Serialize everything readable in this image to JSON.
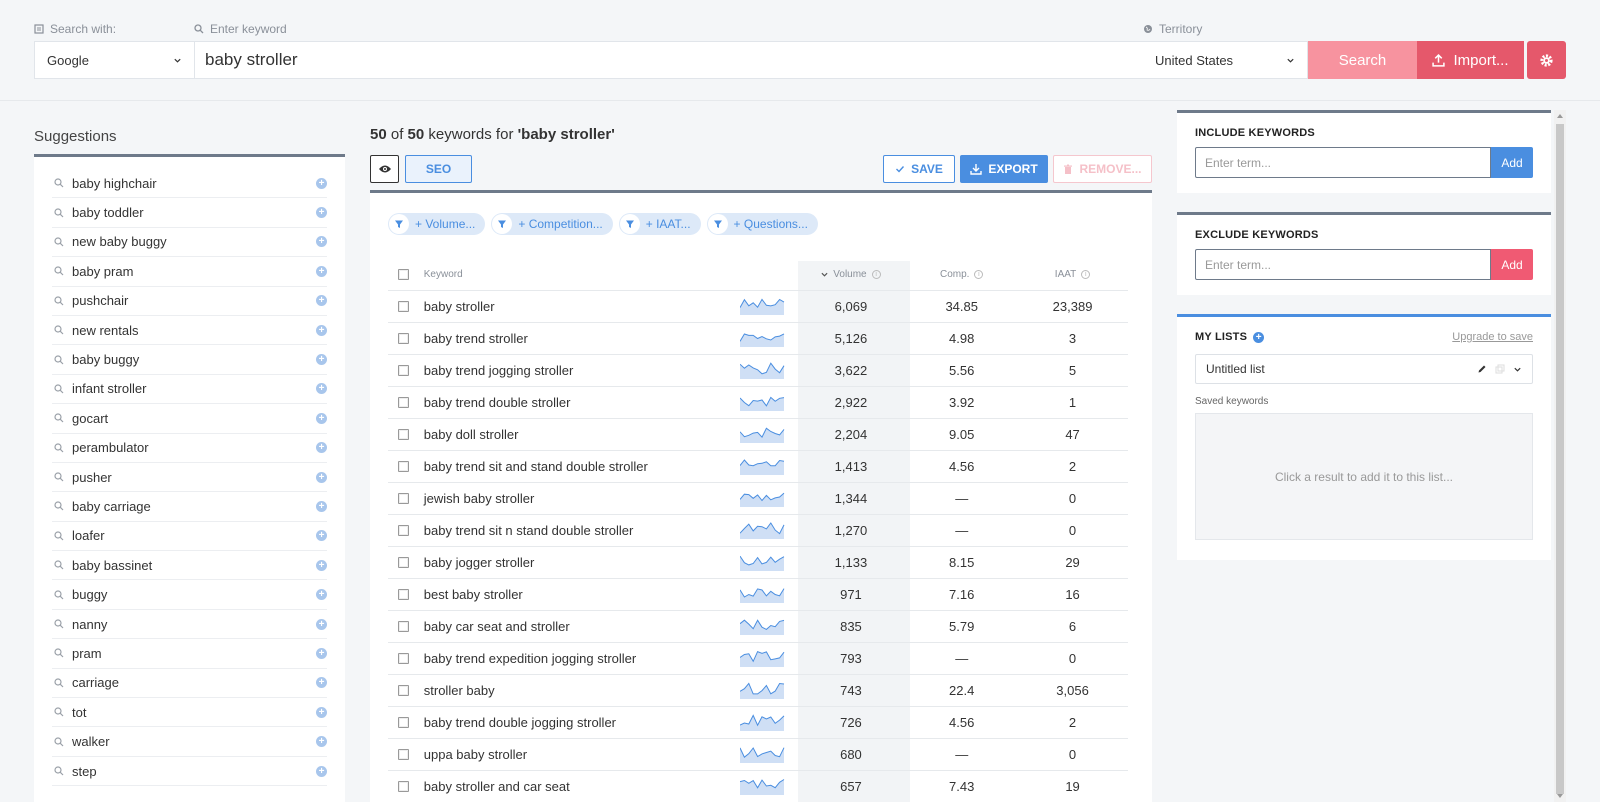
{
  "search": {
    "search_with_label": "Search with:",
    "keyword_label": "Enter keyword",
    "territory_label": "Territory",
    "engine": "Google",
    "keyword_value": "baby stroller",
    "territory": "United States",
    "search_button": "Search",
    "import_button": "Import..."
  },
  "suggestions": {
    "title": "Suggestions",
    "items": [
      "baby highchair",
      "baby toddler",
      "new baby buggy",
      "baby pram",
      "pushchair",
      "new rentals",
      "baby buggy",
      "infant stroller",
      "gocart",
      "perambulator",
      "pusher",
      "baby carriage",
      "loafer",
      "baby bassinet",
      "buggy",
      "nanny",
      "pram",
      "carriage",
      "tot",
      "walker",
      "step"
    ]
  },
  "results": {
    "count_shown": "50",
    "of_text": "of",
    "count_total": "50",
    "keywords_for": "keywords for",
    "query": "'baby stroller'",
    "seo_button": "SEO",
    "save_button": "SAVE",
    "export_button": "EXPORT",
    "remove_button": "REMOVE...",
    "filters": [
      "+ Volume...",
      "+ Competition...",
      "+ IAAT...",
      "+ Questions..."
    ],
    "columns": {
      "keyword": "Keyword",
      "volume": "Volume",
      "comp": "Comp.",
      "iaat": "IAAT"
    },
    "rows": [
      {
        "keyword": "baby stroller",
        "volume": "6,069",
        "comp": "34.85",
        "iaat": "23,389"
      },
      {
        "keyword": "baby trend stroller",
        "volume": "5,126",
        "comp": "4.98",
        "iaat": "3"
      },
      {
        "keyword": "baby trend jogging stroller",
        "volume": "3,622",
        "comp": "5.56",
        "iaat": "5"
      },
      {
        "keyword": "baby trend double stroller",
        "volume": "2,922",
        "comp": "3.92",
        "iaat": "1"
      },
      {
        "keyword": "baby doll stroller",
        "volume": "2,204",
        "comp": "9.05",
        "iaat": "47"
      },
      {
        "keyword": "baby trend sit and stand double stroller",
        "volume": "1,413",
        "comp": "4.56",
        "iaat": "2"
      },
      {
        "keyword": "jewish baby stroller",
        "volume": "1,344",
        "comp": "—",
        "iaat": "0"
      },
      {
        "keyword": "baby trend sit n stand double stroller",
        "volume": "1,270",
        "comp": "—",
        "iaat": "0"
      },
      {
        "keyword": "baby jogger stroller",
        "volume": "1,133",
        "comp": "8.15",
        "iaat": "29"
      },
      {
        "keyword": "best baby stroller",
        "volume": "971",
        "comp": "7.16",
        "iaat": "16"
      },
      {
        "keyword": "baby car seat and stroller",
        "volume": "835",
        "comp": "5.79",
        "iaat": "6"
      },
      {
        "keyword": "baby trend expedition jogging stroller",
        "volume": "793",
        "comp": "—",
        "iaat": "0"
      },
      {
        "keyword": "stroller baby",
        "volume": "743",
        "comp": "22.4",
        "iaat": "3,056"
      },
      {
        "keyword": "baby trend double jogging stroller",
        "volume": "726",
        "comp": "4.56",
        "iaat": "2"
      },
      {
        "keyword": "uppa baby stroller",
        "volume": "680",
        "comp": "—",
        "iaat": "0"
      },
      {
        "keyword": "baby stroller and car seat",
        "volume": "657",
        "comp": "7.43",
        "iaat": "19"
      }
    ]
  },
  "include": {
    "title": "INCLUDE KEYWORDS",
    "placeholder": "Enter term...",
    "add": "Add"
  },
  "exclude": {
    "title": "EXCLUDE KEYWORDS",
    "placeholder": "Enter term...",
    "add": "Add"
  },
  "mylists": {
    "title": "MY LISTS",
    "upgrade": "Upgrade to save",
    "list_name": "Untitled list",
    "saved_label": "Saved keywords",
    "empty_text": "Click a result to add it to this list..."
  },
  "colors": {
    "accent_blue": "#4a8ee0",
    "search_pink": "#f7939f",
    "import_red": "#e5586b",
    "exclude_add": "#f05a73"
  }
}
